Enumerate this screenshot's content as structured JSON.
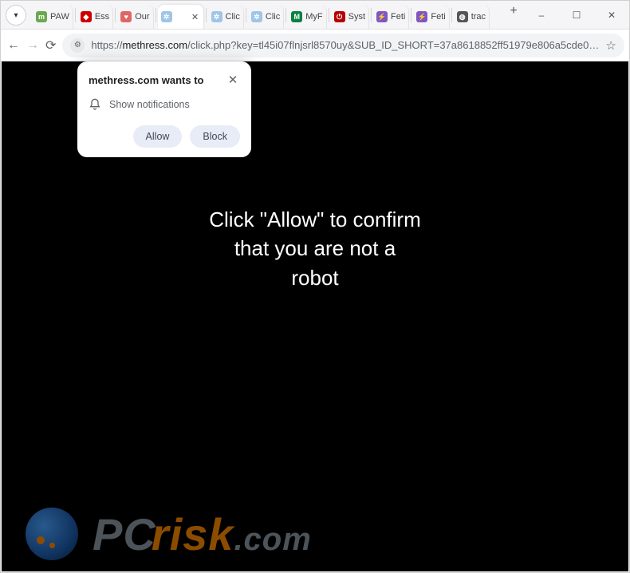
{
  "window_controls": {
    "minimize": "–",
    "maximize": "☐",
    "close": "✕"
  },
  "tabs": [
    {
      "title": "PAW",
      "favicon_bg": "#6aa84f",
      "favicon_txt": "m"
    },
    {
      "title": "Ess",
      "favicon_bg": "#cc0000",
      "favicon_txt": "◆"
    },
    {
      "title": "Our",
      "favicon_bg": "#e06666",
      "favicon_txt": "♥"
    },
    {
      "title": "",
      "favicon_bg": "#9fc5e8",
      "favicon_txt": "✲",
      "active": true
    },
    {
      "title": "Clic",
      "favicon_bg": "#9fc5e8",
      "favicon_txt": "✲"
    },
    {
      "title": "Clic",
      "favicon_bg": "#9fc5e8",
      "favicon_txt": "✲"
    },
    {
      "title": "MyF",
      "favicon_bg": "#0b8043",
      "favicon_txt": "M"
    },
    {
      "title": "Syst",
      "favicon_bg": "#b60205",
      "favicon_txt": "⏻"
    },
    {
      "title": "Feti",
      "favicon_bg": "#7e57c2",
      "favicon_txt": "⚡"
    },
    {
      "title": "Feti",
      "favicon_bg": "#7e57c2",
      "favicon_txt": "⚡"
    },
    {
      "title": "trac",
      "favicon_bg": "#555555",
      "favicon_txt": "◍"
    }
  ],
  "toolbar": {
    "new_tab": "+",
    "url_scheme": "https://",
    "url_host": "methress.com",
    "url_path": "/click.php?key=tl45i07flnjsrl8570uy&SUB_ID_SHORT=37a8618852ff51979e806a5cde0…"
  },
  "permission": {
    "title": "methress.com wants to",
    "label": "Show notifications",
    "allow": "Allow",
    "block": "Block"
  },
  "page": {
    "hero_l1": "Click \"Allow\" to confirm",
    "hero_l2": "that you are not a",
    "hero_l3": "robot"
  },
  "watermark": {
    "pc": "PC",
    "risk": "risk",
    "com": ".com"
  }
}
